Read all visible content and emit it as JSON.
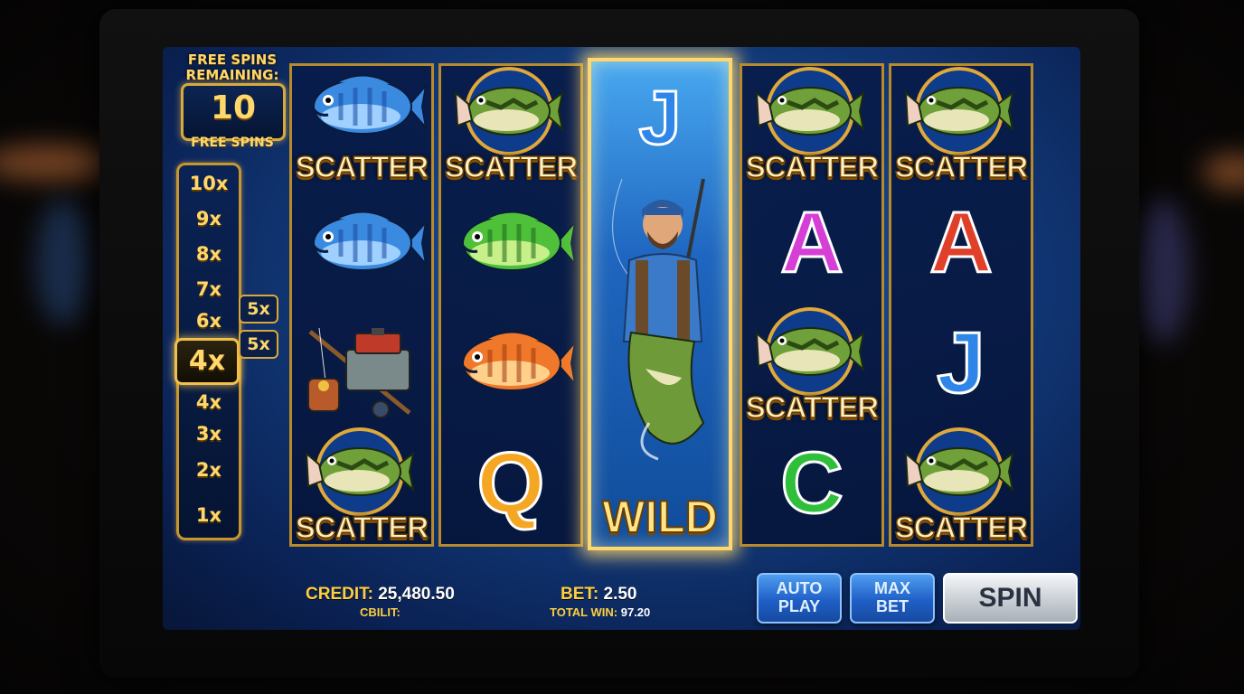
{
  "free_spins": {
    "title_line1": "FREE SPINS",
    "title_line2": "REMAINING:",
    "count": "10",
    "subtitle": "FREE SPINS"
  },
  "multiplier_ladder": [
    "10x",
    "9x",
    "8x",
    "7x",
    "6x",
    "4x",
    "4x",
    "3x",
    "2x",
    "1x"
  ],
  "active_multiplier": "4x",
  "side_badges": [
    "5x",
    "5x"
  ],
  "reels": [
    {
      "symbols": [
        {
          "type": "scatter",
          "icon": "blue-fish-icon",
          "label": "SCATTER"
        },
        {
          "type": "icon",
          "icon": "blue-fish-icon"
        },
        {
          "type": "icon",
          "icon": "tackle-box-icon"
        },
        {
          "type": "scatter",
          "icon": "bass-fish-icon",
          "label": "SCATTER"
        }
      ]
    },
    {
      "symbols": [
        {
          "type": "scatter",
          "icon": "bass-fish-icon",
          "label": "SCATTER"
        },
        {
          "type": "icon",
          "icon": "green-fish-icon"
        },
        {
          "type": "icon",
          "icon": "orange-fish-icon"
        },
        {
          "type": "letter",
          "text": "Q",
          "color": "#f5a623"
        }
      ]
    },
    {
      "wild": true,
      "top_letter": "J",
      "icon": "fisherman-icon",
      "label": "WILD"
    },
    {
      "symbols": [
        {
          "type": "scatter",
          "icon": "bass-fish-icon",
          "label": "SCATTER"
        },
        {
          "type": "letter",
          "text": "A",
          "color": "#d63fd6"
        },
        {
          "type": "scatter",
          "icon": "bass-fish-icon",
          "label": "SCATTER"
        },
        {
          "type": "letter",
          "text": "C",
          "color": "#2fbf3a"
        }
      ]
    },
    {
      "symbols": [
        {
          "type": "scatter",
          "icon": "bass-fish-icon",
          "label": "SCATTER"
        },
        {
          "type": "letter",
          "text": "A",
          "color": "#e0402a"
        },
        {
          "type": "letter",
          "text": "J",
          "color": "#2f86e8"
        },
        {
          "type": "scatter",
          "icon": "bass-fish-icon",
          "label": "SCATTER"
        }
      ]
    }
  ],
  "footer": {
    "credit_label": "CREDIT:",
    "credit_value": "25,480.50",
    "credit_sub": "CBILIT:",
    "bet_label": "BET:",
    "bet_value": "2.50",
    "total_win_label": "TOTAL WIN:",
    "total_win_value": "97.20"
  },
  "buttons": {
    "auto_play_line1": "AUTO",
    "auto_play_line2": "PLAY",
    "max_bet_line1": "MAX",
    "max_bet_line2": "BET",
    "spin": "SPIN"
  }
}
